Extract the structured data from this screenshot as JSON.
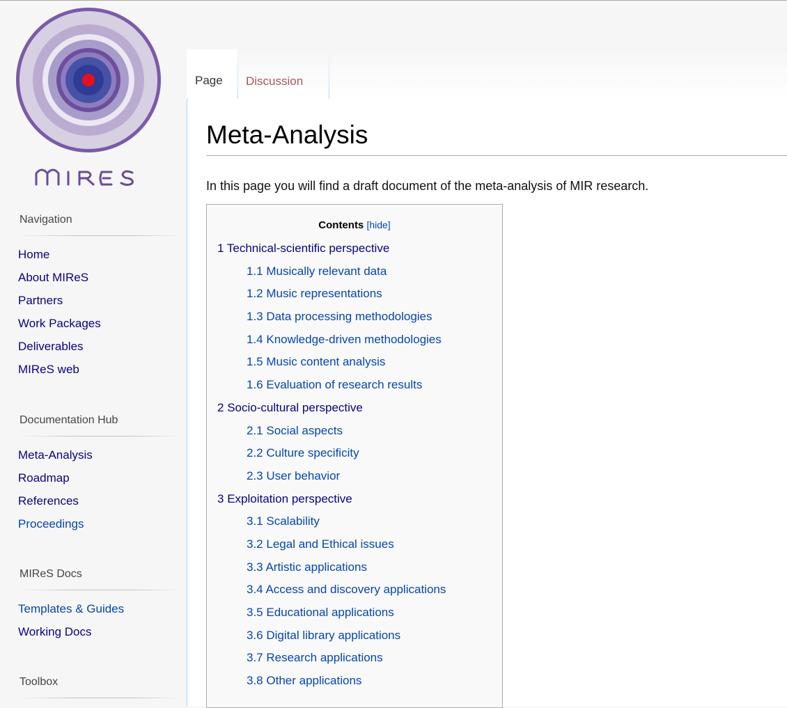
{
  "logo": {
    "text": "MIRES"
  },
  "tabs": [
    {
      "label": "Page"
    },
    {
      "label": "Discussion"
    }
  ],
  "sidebar": {
    "navigation": {
      "heading": "Navigation",
      "items": [
        "Home",
        "About MIReS",
        "Partners",
        "Work Packages",
        "Deliverables",
        "MIReS web"
      ]
    },
    "documentation": {
      "heading": "Documentation Hub",
      "items": [
        "Meta-Analysis",
        "Roadmap",
        "References",
        "Proceedings"
      ]
    },
    "docs": {
      "heading": "MIReS Docs",
      "items": [
        "Templates & Guides",
        "Working Docs"
      ]
    },
    "toolbox": {
      "heading": "Toolbox"
    }
  },
  "article": {
    "title": "Meta-Analysis",
    "intro": "In this page you will find a draft document of the meta-analysis of MIR research."
  },
  "toc": {
    "title": "Contents",
    "toggle": "[hide]",
    "items": [
      {
        "number": "1",
        "text": "Technical-scientific perspective",
        "level": 1
      },
      {
        "number": "1.1",
        "text": "Musically relevant data",
        "level": 2
      },
      {
        "number": "1.2",
        "text": "Music representations",
        "level": 2
      },
      {
        "number": "1.3",
        "text": "Data processing methodologies",
        "level": 2
      },
      {
        "number": "1.4",
        "text": "Knowledge-driven methodologies",
        "level": 2
      },
      {
        "number": "1.5",
        "text": "Music content analysis",
        "level": 2
      },
      {
        "number": "1.6",
        "text": "Evaluation of research results",
        "level": 2
      },
      {
        "number": "2",
        "text": "Socio-cultural perspective",
        "level": 1
      },
      {
        "number": "2.1",
        "text": "Social aspects",
        "level": 2
      },
      {
        "number": "2.2",
        "text": "Culture specificity",
        "level": 2
      },
      {
        "number": "2.3",
        "text": "User behavior",
        "level": 2
      },
      {
        "number": "3",
        "text": "Exploitation perspective",
        "level": 1
      },
      {
        "number": "3.1",
        "text": "Scalability",
        "level": 2
      },
      {
        "number": "3.2",
        "text": "Legal and Ethical issues",
        "level": 2
      },
      {
        "number": "3.3",
        "text": "Artistic applications",
        "level": 2
      },
      {
        "number": "3.4",
        "text": "Access and discovery applications",
        "level": 2
      },
      {
        "number": "3.5",
        "text": "Educational applications",
        "level": 2
      },
      {
        "number": "3.6",
        "text": "Digital library applications",
        "level": 2
      },
      {
        "number": "3.7",
        "text": "Research applications",
        "level": 2
      },
      {
        "number": "3.8",
        "text": "Other applications",
        "level": 2
      }
    ]
  },
  "colors": {
    "link": "#0645ad",
    "link_visited": "#0b0080",
    "discussion_tab": "#a55858",
    "content_border": "#a7d7f9",
    "logo_outer": "#7b5aa6",
    "logo_center": "#e8101a"
  }
}
